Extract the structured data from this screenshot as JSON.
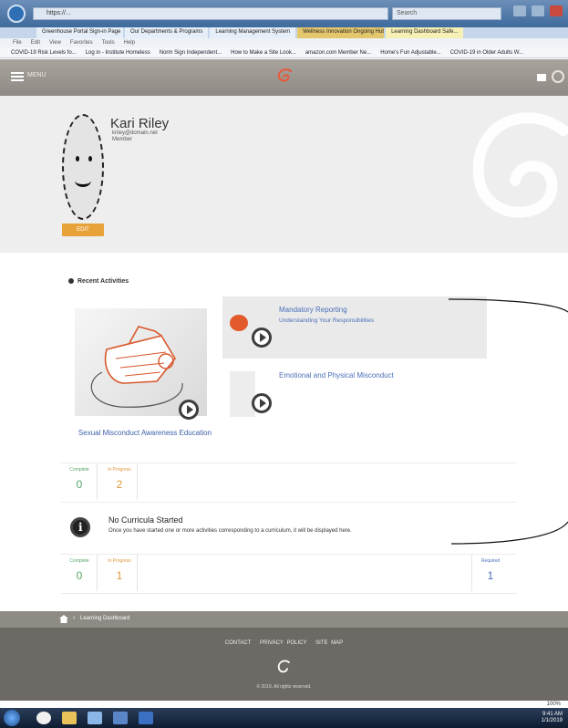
{
  "browser": {
    "address": "https://...",
    "search_placeholder": "Search",
    "tabs": [
      "Greenhouse Portal Sign-in Page",
      "Our Departments & Programs",
      "Learning Management System",
      "Wellness Innovation Ongoing Hub",
      "Learning Dashboard Safe..."
    ],
    "active_tab_index": 4,
    "menu_items": [
      "File",
      "Edit",
      "View",
      "Favorites",
      "Tools",
      "Help"
    ],
    "favorites": [
      "COVID-19 Risk Levels fo...",
      "Log in - Institute Homeless",
      "Norm Sign Independent...",
      "How to Make a Site Look...",
      "amazon.com Member Ne...",
      "Home's Fun Adjustable...",
      "COVID-19 in Older Adults W..."
    ]
  },
  "header": {
    "menu_label": "MENU",
    "colors": {
      "bar": "#9c9791"
    }
  },
  "profile": {
    "name": "Kari Riley",
    "email": "kriley@domain.net",
    "role": "Member",
    "edit_label": "EDIT",
    "accent": "#e8a23a"
  },
  "recent": {
    "title": "Recent Activities",
    "featured": {
      "title": "Sexual Misconduct Awareness Education",
      "icon": "whistle-icon"
    },
    "items": [
      {
        "title": "Mandatory Reporting",
        "subtitle": "Understanding Your Responsibilities"
      },
      {
        "title": "Emotional and Physical Misconduct",
        "subtitle": ""
      }
    ],
    "stats": [
      {
        "label": "Complete",
        "value": "0"
      },
      {
        "label": "In Progress",
        "value": "2"
      }
    ]
  },
  "curricula": {
    "title": "No Curricula Started",
    "text": "Once you have started one or more activities corresponding to a curriculum, it will be displayed here.",
    "stats": [
      {
        "label": "Complete",
        "value": "0"
      },
      {
        "label": "In Progress",
        "value": "1"
      },
      {
        "label": "Required",
        "value": "1"
      }
    ]
  },
  "footer": {
    "breadcrumb": "Learning Dashboard",
    "links": [
      "CONTACT",
      "PRIVACY POLICY",
      "SITE MAP"
    ],
    "copyright": "© 2019. All rights reserved."
  },
  "statusbar": {
    "zoom": "100%"
  },
  "taskbar": {
    "time": "9:41 AM",
    "date": "1/1/2019"
  }
}
